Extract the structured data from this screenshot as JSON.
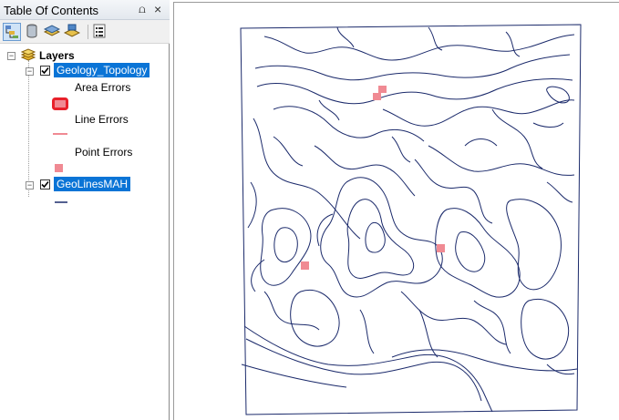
{
  "toc": {
    "title": "Table Of Contents",
    "pin_glyph": "⩍",
    "close_glyph": "×",
    "toolbar": [
      {
        "name": "list-by-drawing-order-button",
        "icon": "drawing-order-icon"
      },
      {
        "name": "list-by-source-button",
        "icon": "source-icon"
      },
      {
        "name": "list-by-visibility-button",
        "icon": "visibility-icon"
      },
      {
        "name": "list-by-selection-button",
        "icon": "selection-icon"
      },
      {
        "name": "options-button",
        "icon": "options-icon"
      }
    ],
    "root_label": "Layers",
    "layers": [
      {
        "name": "Geology_Topology",
        "checked": true,
        "legend": [
          {
            "label": "Area Errors",
            "symbol": "area",
            "color": "#e8202a"
          },
          {
            "label": "Line Errors",
            "symbol": "line",
            "color": "#f08a93"
          },
          {
            "label": "Point Errors",
            "symbol": "point",
            "color": "#f08a93"
          }
        ]
      },
      {
        "name": "GeoLinesMAH",
        "checked": true,
        "legend": [
          {
            "label": "",
            "symbol": "line",
            "color": "#1b2a6b"
          }
        ]
      }
    ]
  },
  "map": {
    "line_color": "#1b2a6b",
    "error_color": "#f08a93",
    "point_errors": [
      {
        "name": "point-error-1"
      },
      {
        "name": "point-error-2"
      },
      {
        "name": "point-error-3"
      },
      {
        "name": "point-error-4"
      }
    ]
  }
}
